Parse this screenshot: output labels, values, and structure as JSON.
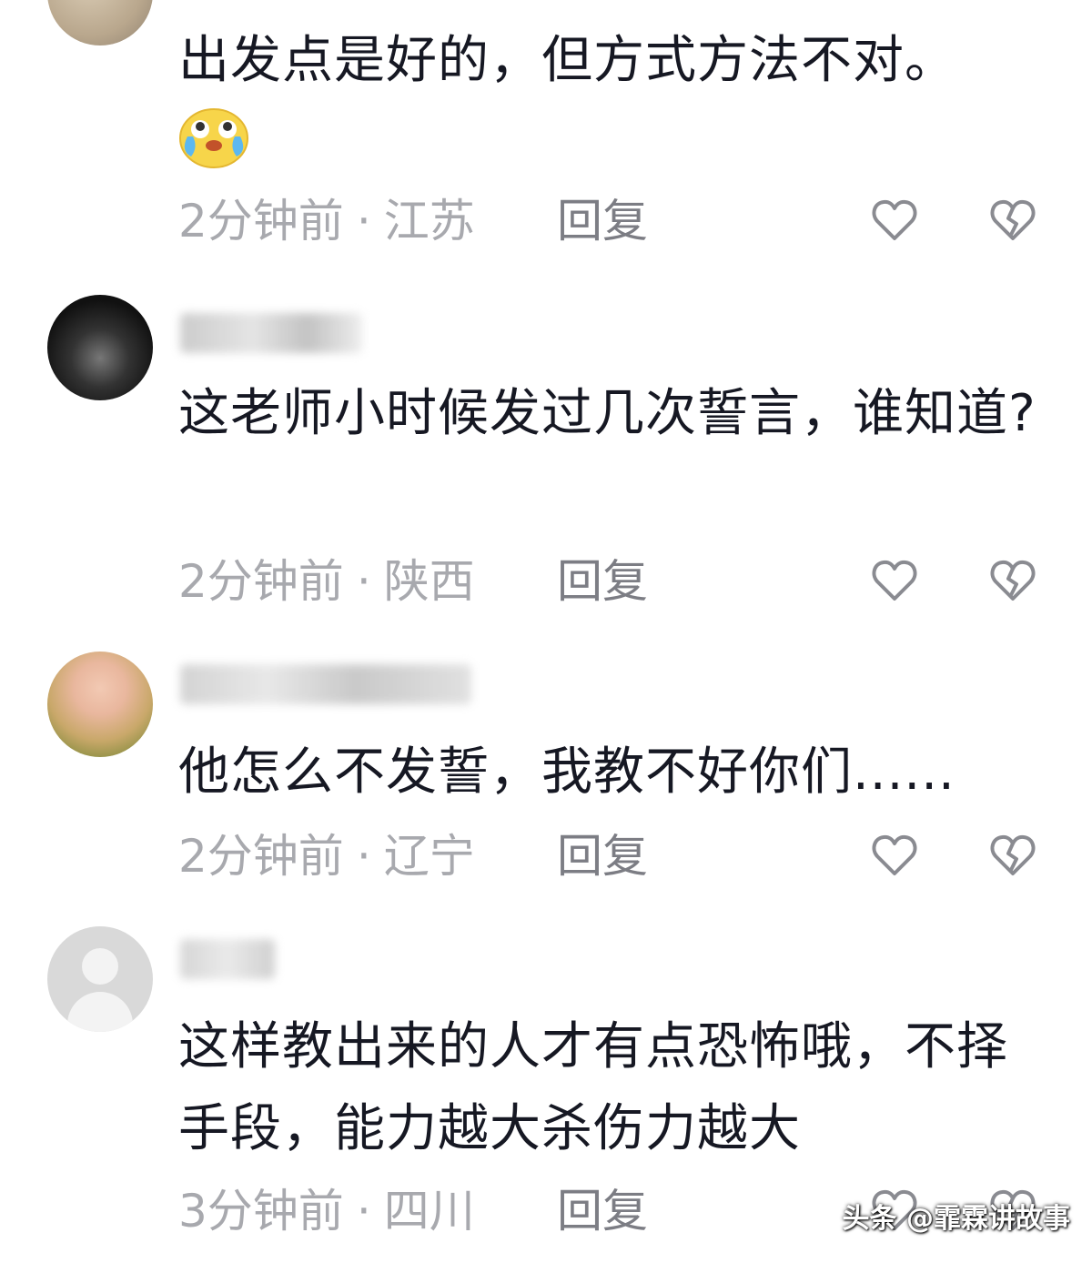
{
  "comments": [
    {
      "text": "出发点是好的，但方式方法不对。",
      "emoji": "crying-laughing-emoji-icon",
      "time": "2分钟前",
      "location": "江苏",
      "reply": "回复"
    },
    {
      "text": "这老师小时候发过几次誓言，谁知道?",
      "time": "2分钟前",
      "location": "陕西",
      "reply": "回复"
    },
    {
      "text": "他怎么不发誓，我教不好你们......",
      "time": "2分钟前",
      "location": "辽宁",
      "reply": "回复"
    },
    {
      "text": "这样教出来的人才有点恐怖哦，不择手段，能力越大杀伤力越大",
      "time": "3分钟前",
      "location": "四川",
      "reply": "回复"
    }
  ],
  "separator": "·",
  "watermark": "头条 @霏霖讲故事",
  "colors": {
    "text": "#161823",
    "meta": "#a8a9ae",
    "icon": "#8a8b91"
  }
}
